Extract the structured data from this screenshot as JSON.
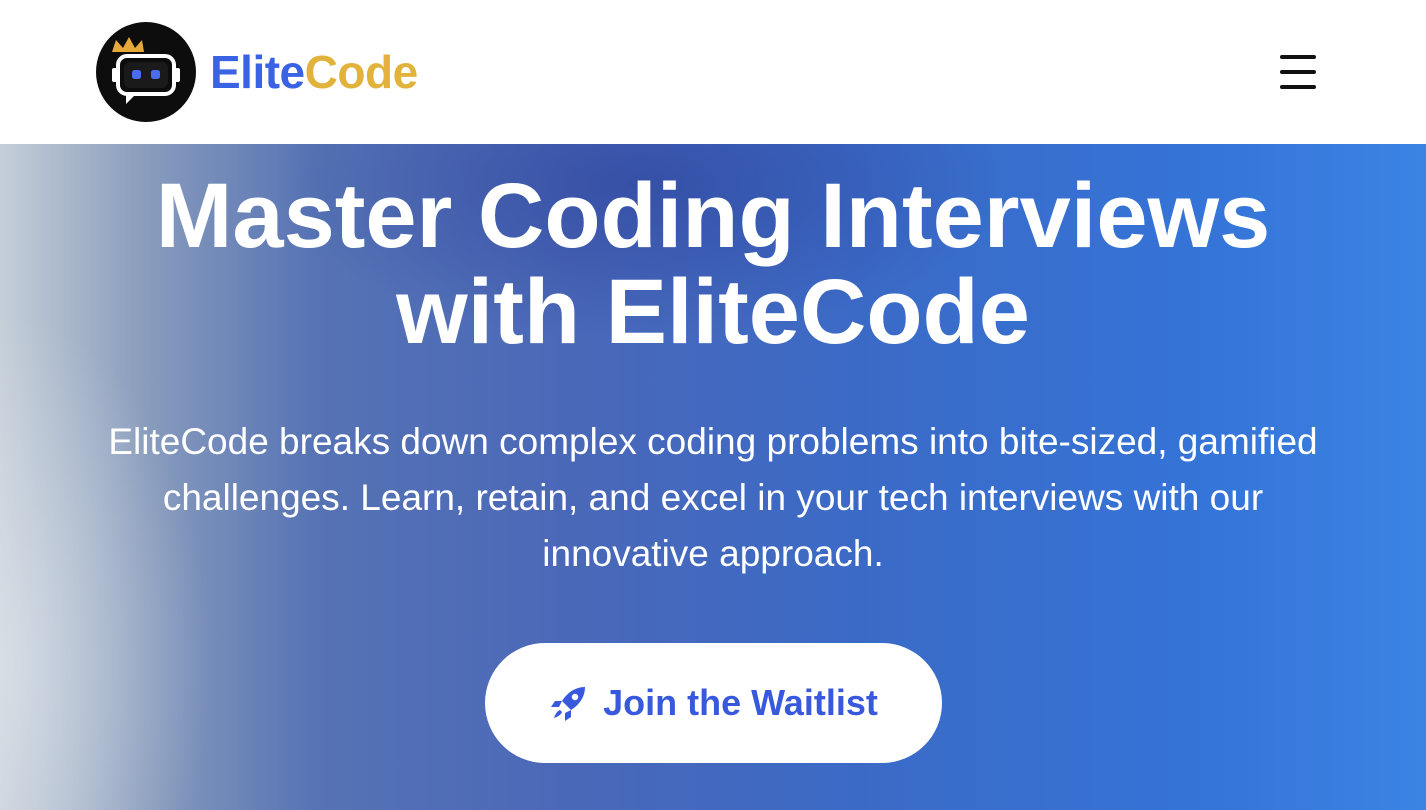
{
  "header": {
    "brand_part1": "Elite",
    "brand_part2": "Code",
    "logo_icon": "robot-chat-crown-icon",
    "menu_icon": "hamburger-menu-icon"
  },
  "hero": {
    "headline_line1": "Master Coding Interviews",
    "headline_line2": "with EliteCode",
    "subtext_line1": "EliteCode breaks down complex coding problems into bite-sized, gamified",
    "subtext_line2": "challenges. Learn, retain, and excel in your tech interviews with our",
    "subtext_line3": "innovative approach.",
    "cta_label": "Join the Waitlist",
    "cta_icon": "rocket-icon"
  },
  "colors": {
    "brand_blue": "#3a63e3",
    "brand_gold": "#e2b33c",
    "cta_text": "#3859de",
    "hero_gradient_end": "#3b84e4"
  }
}
